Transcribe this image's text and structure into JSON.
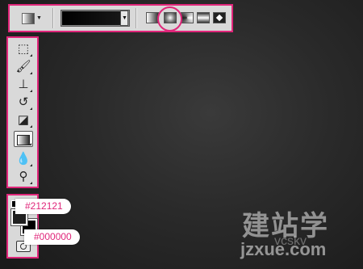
{
  "options_bar": {
    "tool_icon": "gradient-tool-icon",
    "gradient_preset": "black-to-dark-gradient",
    "gradient_types": [
      "linear",
      "radial",
      "angle",
      "reflected",
      "diamond"
    ],
    "selected_type": "radial"
  },
  "tools": [
    {
      "name": "marquee",
      "icon": "marquee-icon"
    },
    {
      "name": "brush",
      "icon": "brush-icon"
    },
    {
      "name": "stamp",
      "icon": "clone-stamp-icon"
    },
    {
      "name": "history-brush",
      "icon": "history-brush-icon"
    },
    {
      "name": "eraser",
      "icon": "eraser-icon"
    },
    {
      "name": "gradient",
      "icon": "gradient-icon",
      "active": true
    },
    {
      "name": "blur",
      "icon": "blur-icon"
    },
    {
      "name": "dodge",
      "icon": "dodge-icon"
    }
  ],
  "colors": {
    "foreground_label": "#212121",
    "background_label": "#000000",
    "foreground": "#212121",
    "background": "#000000",
    "accent": "#e0267a"
  },
  "watermark": {
    "cn": "建站学",
    "en": "jzxue.com",
    "sub": "vcskv"
  }
}
